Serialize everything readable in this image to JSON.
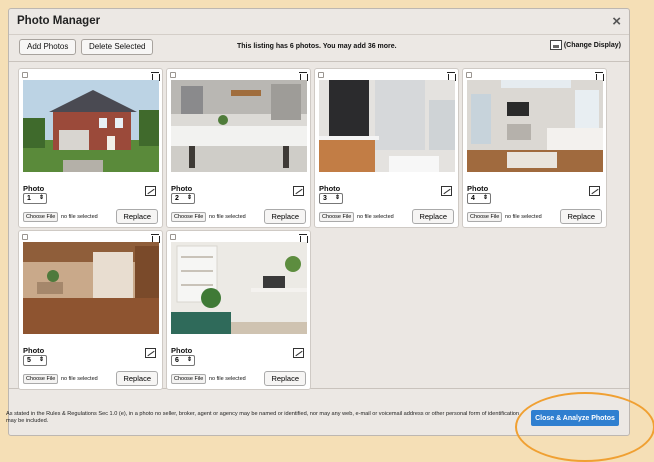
{
  "dialog": {
    "title": "Photo Manager",
    "close_icon": "×"
  },
  "toolbar": {
    "add_label": "Add Photos",
    "delete_label": "Delete Selected",
    "info": "This listing has 6 photos. You may add 36 more.",
    "display_label": "(Change Display)"
  },
  "photos": [
    {
      "label": "Photo",
      "number": "1",
      "choose": "Choose File",
      "nofile": "no file selected",
      "replace": "Replace"
    },
    {
      "label": "Photo",
      "number": "2",
      "choose": "Choose File",
      "nofile": "no file selected",
      "replace": "Replace"
    },
    {
      "label": "Photo",
      "number": "3",
      "choose": "Choose File",
      "nofile": "no file selected",
      "replace": "Replace"
    },
    {
      "label": "Photo",
      "number": "4",
      "choose": "Choose File",
      "nofile": "no file selected",
      "replace": "Replace"
    },
    {
      "label": "Photo",
      "number": "5",
      "choose": "Choose File",
      "nofile": "no file selected",
      "replace": "Replace"
    },
    {
      "label": "Photo",
      "number": "6",
      "choose": "Choose File",
      "nofile": "no file selected",
      "replace": "Replace"
    }
  ],
  "footer": {
    "disclaimer": "As stated in the Rules & Regulations Sec 1.0 (e), in a photo no seller, broker, agent or agency may be named or identified, nor may any web, e-mail or voicemail address or other personal form of identification may be included.",
    "analyze_label": "Close & Analyze Photos"
  },
  "colors": {
    "accent": "#2f7fd0",
    "highlight_ring": "#f0a032"
  }
}
